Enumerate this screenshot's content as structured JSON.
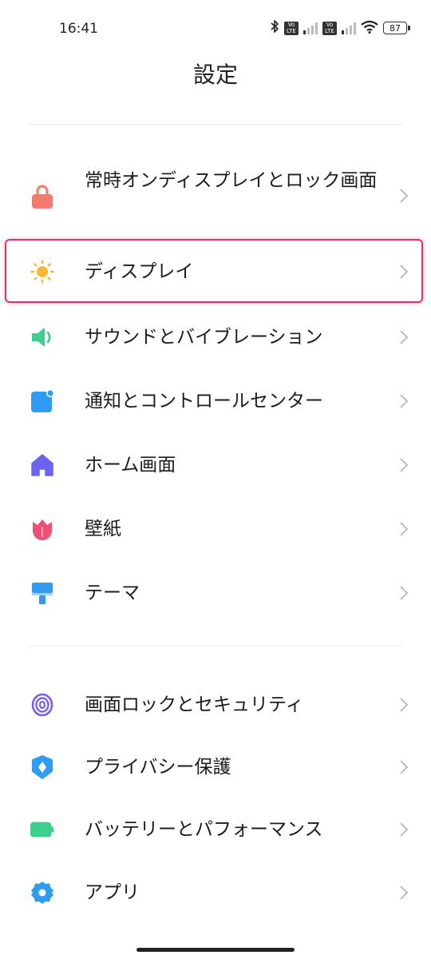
{
  "status": {
    "time": "16:41",
    "volte_top": "Vo",
    "volte_bottom": "LTE",
    "battery": "87"
  },
  "page": {
    "title": "設定"
  },
  "groups": [
    {
      "items": [
        {
          "label": "常時オンディスプレイとロック画面",
          "icon": "lock-icon",
          "color": "#f47a6b"
        },
        {
          "label": "ディスプレイ",
          "icon": "sun-icon",
          "color": "#f7b731",
          "highlighted": true
        },
        {
          "label": "サウンドとバイブレーション",
          "icon": "speaker-icon",
          "color": "#3ecf8e"
        },
        {
          "label": "通知とコントロールセンター",
          "icon": "notification-icon",
          "color": "#2f9cf4"
        },
        {
          "label": "ホーム画面",
          "icon": "home-icon",
          "color": "#6c63f0"
        },
        {
          "label": "壁紙",
          "icon": "tulip-icon",
          "color": "#ef4f75"
        },
        {
          "label": "テーマ",
          "icon": "brush-icon",
          "color": "#2f9cf4"
        }
      ]
    },
    {
      "items": [
        {
          "label": "画面ロックとセキュリティ",
          "icon": "fingerprint-icon",
          "color": "#7a5ef0"
        },
        {
          "label": "プライバシー保護",
          "icon": "shield-icon",
          "color": "#2f9cf4"
        },
        {
          "label": "バッテリーとパフォーマンス",
          "icon": "battery-icon",
          "color": "#3ecf8e"
        },
        {
          "label": "アプリ",
          "icon": "gear-icon",
          "color": "#2f9cf4"
        }
      ]
    }
  ]
}
